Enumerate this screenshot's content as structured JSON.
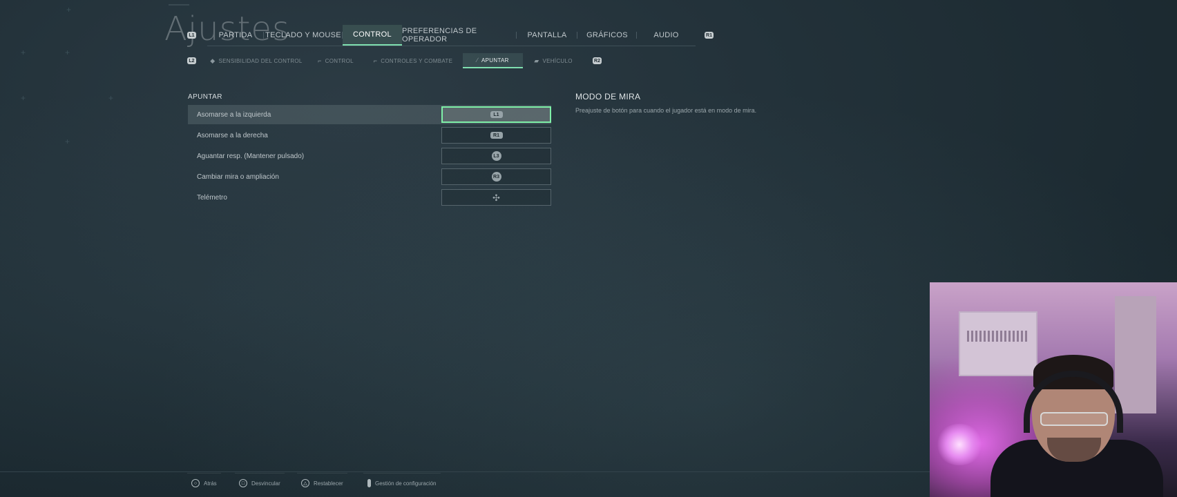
{
  "page": {
    "title": "Ajustes"
  },
  "top_nav": {
    "left_badge": "L1",
    "right_badge": "R1",
    "tabs": [
      {
        "label": "PARTIDA",
        "active": false
      },
      {
        "label": "TECLADO Y MOUSE",
        "active": false
      },
      {
        "label": "CONTROL",
        "active": true
      },
      {
        "label": "PREFERENCIAS DE OPERADOR",
        "active": false
      },
      {
        "label": "PANTALLA",
        "active": false
      },
      {
        "label": "GRÁFICOS",
        "active": false
      },
      {
        "label": "AUDIO",
        "active": false
      }
    ]
  },
  "sub_nav": {
    "left_badge": "L2",
    "right_badge": "R2",
    "tabs": [
      {
        "label": "SENSIBILIDAD DEL CONTROL",
        "icon": "gamepad-icon",
        "active": false
      },
      {
        "label": "CONTROL",
        "icon": "gun-icon",
        "active": false
      },
      {
        "label": "CONTROLES Y COMBATE",
        "icon": "rifle-icon",
        "active": false
      },
      {
        "label": "APUNTAR",
        "icon": "knife-icon",
        "active": true
      },
      {
        "label": "VEHÍCULO",
        "icon": "vehicle-icon",
        "active": false
      }
    ]
  },
  "section": {
    "label": "APUNTAR",
    "rows": [
      {
        "label": "Asomarse a la izquierda",
        "binding": "L1",
        "selected": true
      },
      {
        "label": "Asomarse a la derecha",
        "binding": "R1",
        "selected": false
      },
      {
        "label": "Aguantar resp. (Mantener pulsado)",
        "binding": "L3",
        "selected": false
      },
      {
        "label": "Cambiar mira o ampliación",
        "binding": "R3",
        "selected": false
      },
      {
        "label": "Telémetro",
        "binding": "dpad-icon",
        "selected": false
      }
    ]
  },
  "description": {
    "title": "MODO DE MIRA",
    "text": "Preajuste de botón para cuando el jugador está en modo de mira."
  },
  "bottom_bar": [
    {
      "icon": "circle-button-icon",
      "label": "Atrás"
    },
    {
      "icon": "square-button-icon",
      "label": "Desvincular"
    },
    {
      "icon": "triangle-button-icon",
      "label": "Restablecer"
    },
    {
      "icon": "touchpad-icon",
      "label": "Gestión de configuración"
    }
  ],
  "colors": {
    "accent": "#7ff0a8",
    "background": "#23323a",
    "text": "#c9d1d4"
  }
}
